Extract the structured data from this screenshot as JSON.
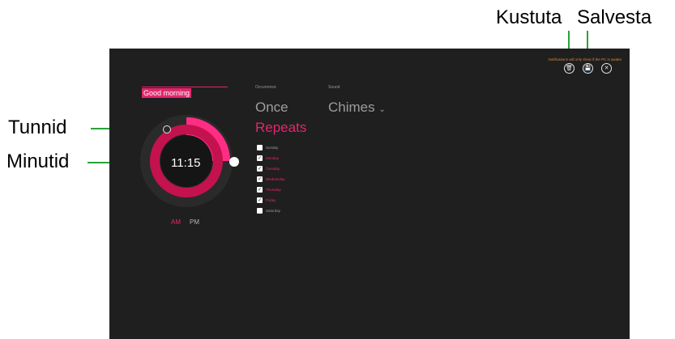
{
  "callouts": {
    "delete": "Kustuta",
    "save": "Salvesta",
    "hours": "Tunnid",
    "minutes": "Minutid"
  },
  "header": {
    "notification": "Notifications will only show if the PC is awake"
  },
  "alarm": {
    "name": "Good morning",
    "time": "11:15",
    "am": "AM",
    "pm": "PM",
    "selected_period": "AM"
  },
  "occurrence": {
    "label": "Occurrence",
    "once": "Once",
    "repeats": "Repeats",
    "selected": "Repeats"
  },
  "sound": {
    "label": "Sound",
    "value": "Chimes",
    "chevron": "⌄"
  },
  "days": [
    {
      "label": "Sunday",
      "checked": false
    },
    {
      "label": "Monday",
      "checked": true
    },
    {
      "label": "Tuesday",
      "checked": true
    },
    {
      "label": "Wednesday",
      "checked": true
    },
    {
      "label": "Thursday",
      "checked": true
    },
    {
      "label": "Friday",
      "checked": true
    },
    {
      "label": "Saturday",
      "checked": false
    }
  ],
  "icons": {
    "delete": "trash-icon",
    "save": "save-icon",
    "close": "close-icon"
  },
  "colors": {
    "accent": "#e3266d",
    "accent_dark": "#c4124f",
    "background": "#1f1f1f",
    "callout": "#27a33a",
    "notification": "#d4873c"
  }
}
